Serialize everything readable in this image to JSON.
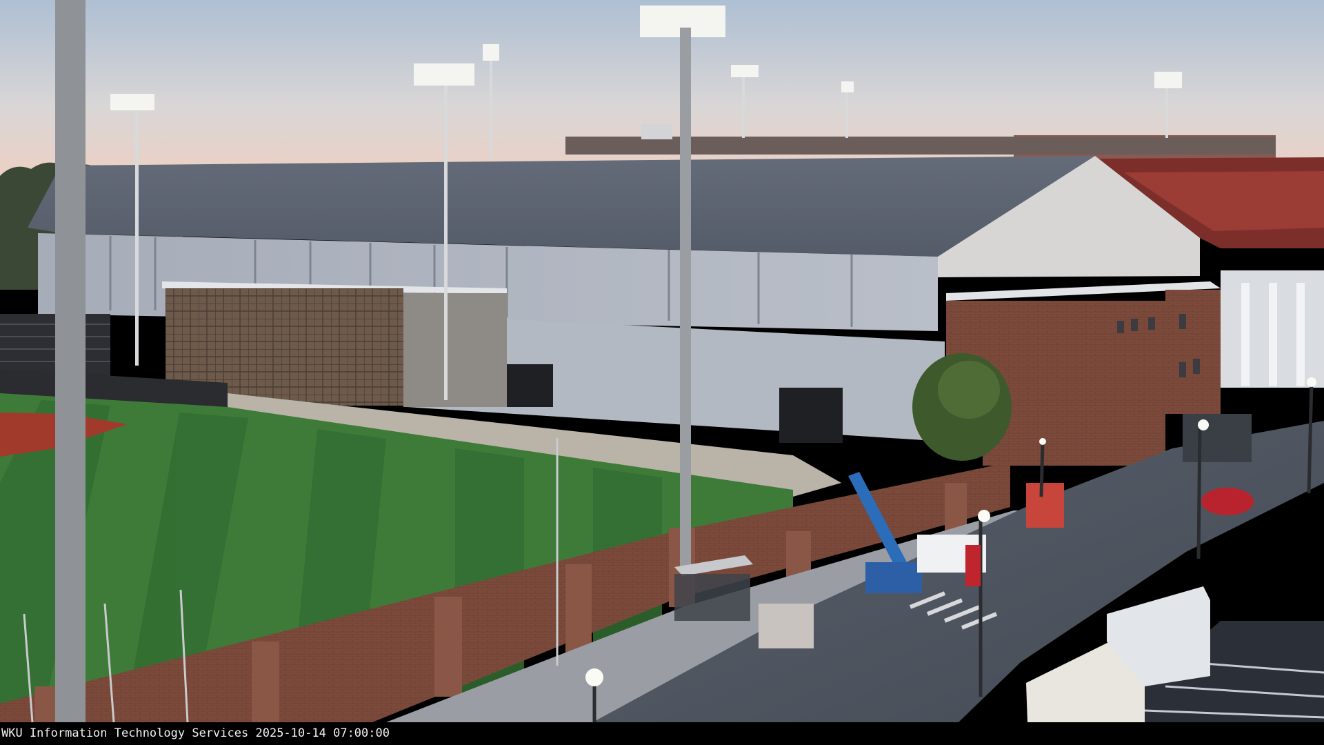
{
  "camera_caption": {
    "organization": "WKU Information Technology Services",
    "date": "2025-10-14",
    "time": "07:00:00"
  },
  "colors": {
    "sky_top": "#aebfd4",
    "sky_horizon": "#f1cfc0",
    "roof": "#5a6271",
    "wall": "#aeb4bf",
    "brick": "#7a4a3c",
    "turf_light": "#3f7b38",
    "turf_dark": "#2f6630",
    "infield_clay": "#a23a2c",
    "street": "#4c525d"
  }
}
